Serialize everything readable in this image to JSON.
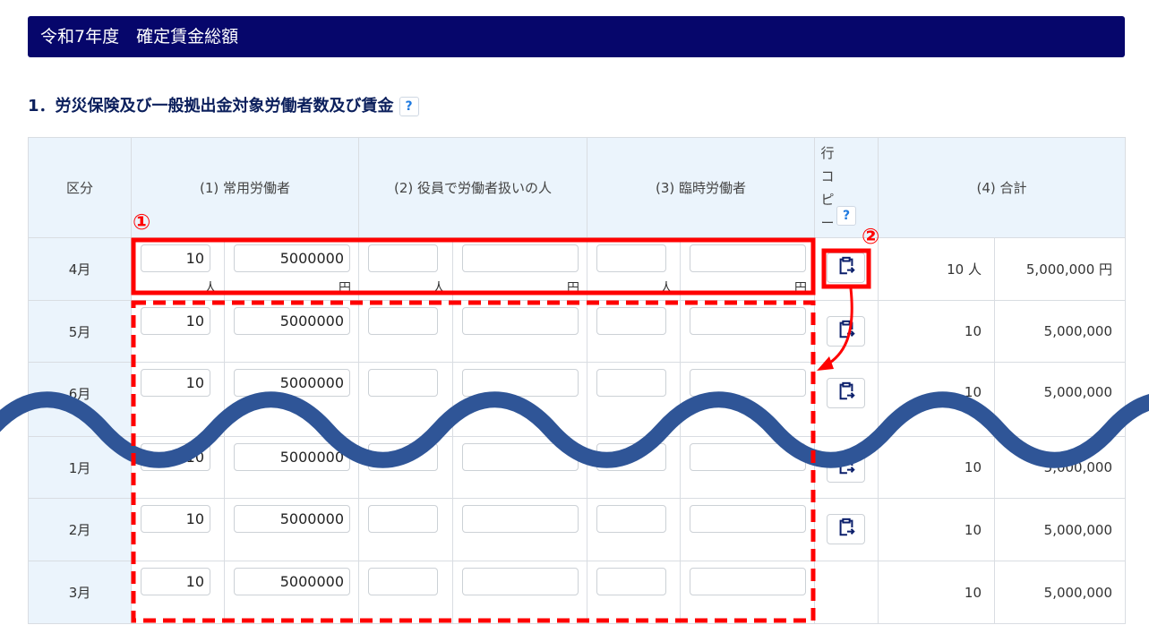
{
  "title": "令和7年度　確定賃金総額",
  "section": "1．労災保険及び一般拠出金対象労働者数及び賃金",
  "help": "?",
  "headers": {
    "kubun": "区分",
    "c1": "(1) 常用労働者",
    "c2": "(2) 役員で労働者扱いの人",
    "c3": "(3) 臨時労働者",
    "copy": [
      "行",
      "コ",
      "ピ",
      "ー"
    ],
    "c4": "(4) 合計"
  },
  "units": {
    "person": "人",
    "yen": "円"
  },
  "rows": [
    {
      "month": "4月",
      "c1_people": "10",
      "c1_wage": "5000000",
      "total_people": "10 人",
      "total_wage": "5,000,000 円"
    },
    {
      "month": "5月",
      "c1_people": "10",
      "c1_wage": "5000000",
      "total_people": "10",
      "total_wage": "5,000,000"
    },
    {
      "month": "6月",
      "c1_people": "10",
      "c1_wage": "5000000",
      "total_people": "10",
      "total_wage": "5,000,000"
    },
    {
      "month": "1月",
      "c1_people": "10",
      "c1_wage": "5000000",
      "total_people": "10",
      "total_wage": "5,000,000"
    },
    {
      "month": "2月",
      "c1_people": "10",
      "c1_wage": "5000000",
      "total_people": "10",
      "total_wage": "5,000,000"
    },
    {
      "month": "3月",
      "c1_people": "10",
      "c1_wage": "5000000",
      "total_people": "10",
      "total_wage": "5,000,000"
    }
  ],
  "annotations": {
    "one": "①",
    "two": "②"
  },
  "colors": {
    "navy": "#06066b",
    "red": "#ff0000",
    "wave": "#2f5597"
  }
}
